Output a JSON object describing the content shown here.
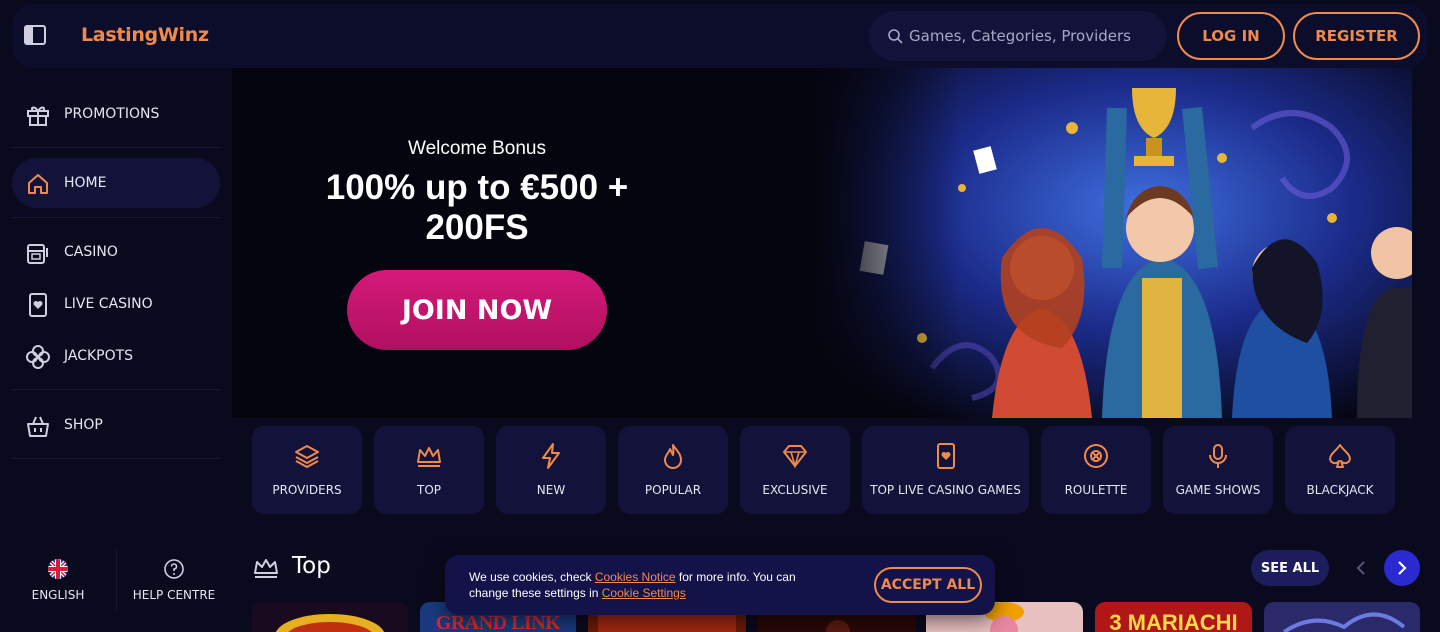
{
  "header": {
    "logo": "LastingWinz",
    "search_placeholder": "Games, Categories, Providers",
    "login_label": "LOG IN",
    "register_label": "REGISTER"
  },
  "sidebar": {
    "items": [
      {
        "label": "PROMOTIONS",
        "icon": "gift-icon"
      },
      {
        "label": "HOME",
        "icon": "home-icon",
        "active": true
      },
      {
        "label": "CASINO",
        "icon": "slot-machine-icon"
      },
      {
        "label": "LIVE CASINO",
        "icon": "card-icon"
      },
      {
        "label": "JACKPOTS",
        "icon": "clover-icon"
      },
      {
        "label": "SHOP",
        "icon": "basket-icon"
      }
    ],
    "footer": {
      "language": "ENGLISH",
      "help": "HELP CENTRE"
    }
  },
  "hero": {
    "subtitle": "Welcome Bonus",
    "title": "100% up to €500 + 200FS",
    "cta": "JOIN NOW"
  },
  "categories": [
    {
      "label": "PROVIDERS",
      "icon": "layers-icon"
    },
    {
      "label": "TOP",
      "icon": "crown-icon"
    },
    {
      "label": "NEW",
      "icon": "lightning-icon"
    },
    {
      "label": "POPULAR",
      "icon": "flame-icon"
    },
    {
      "label": "EXCLUSIVE",
      "icon": "diamond-icon"
    },
    {
      "label": "TOP LIVE CASINO GAMES",
      "icon": "card-icon"
    },
    {
      "label": "ROULETTE",
      "icon": "roulette-icon"
    },
    {
      "label": "GAME SHOWS",
      "icon": "microphone-icon"
    },
    {
      "label": "BLACKJACK",
      "icon": "spade-icon"
    }
  ],
  "top_section": {
    "title": "Top",
    "see_all": "SEE ALL"
  },
  "cookie": {
    "text_1": "We use cookies, check ",
    "link_1": "Cookies Notice",
    "text_2": " for more info. You can change these settings in ",
    "link_2": "Cookie Settings",
    "accept": "ACCEPT ALL"
  },
  "game_tiles": [
    "GRAND LINK",
    "3 MARIACHI"
  ],
  "colors": {
    "accent": "#f08a4b",
    "cta": "#d5197a",
    "background": "#0a0a1f",
    "panel": "#12123a",
    "link_blue": "#2a2ad0"
  }
}
